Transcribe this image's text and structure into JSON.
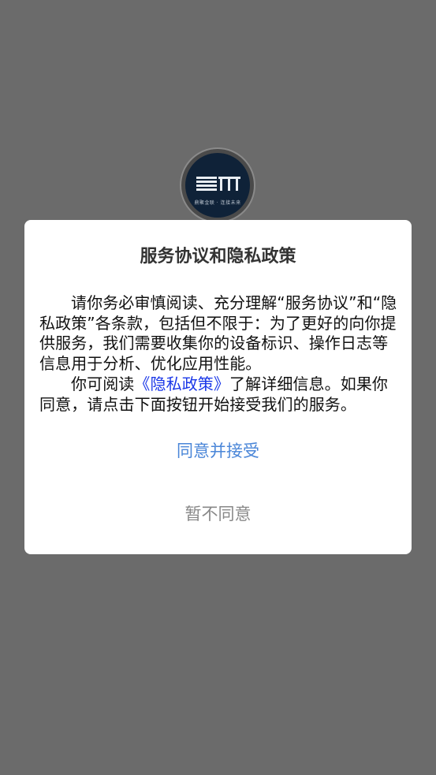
{
  "splash": {
    "logo_tagline": "鼎聚金联 · 连接未来"
  },
  "dialog": {
    "title": "服务协议和隐私政策",
    "paragraph1": "请你务必审慎阅读、充分理解“服务协议”和“隐私政策”各条款，包括但不限于：为了更好的向你提供服务，我们需要收集你的设备标识、操作日志等信息用于分析、优化应用性能。",
    "paragraph2_before": "你可阅读",
    "paragraph2_link": "《隐私政策》",
    "paragraph2_after": "了解详细信息。如果你同意，请点击下面按钮开始接受我们的服务。",
    "accept_label": "同意并接受",
    "decline_label": "暂不同意"
  },
  "colors": {
    "overlay": "#6b6b6b",
    "link": "#1a37e8",
    "accept": "#4a86d8",
    "decline": "#888888"
  }
}
